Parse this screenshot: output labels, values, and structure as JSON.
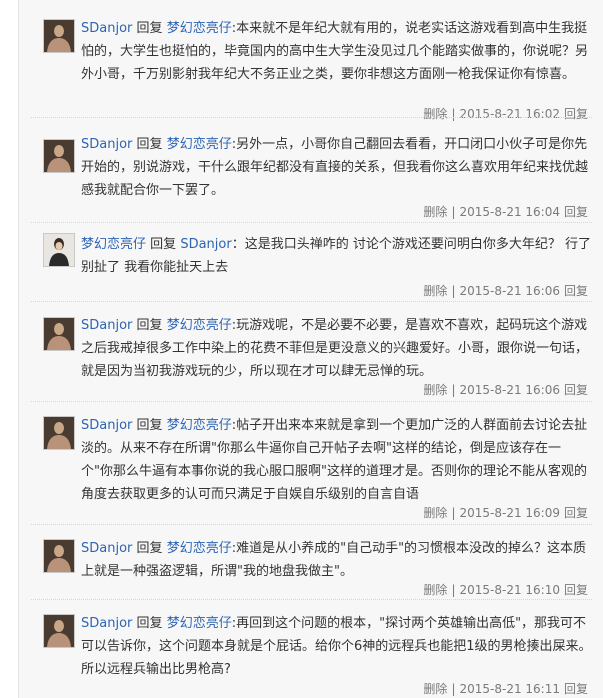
{
  "comments": [
    {
      "author": "SDanjor",
      "reply_word": "回复",
      "target": "梦幻恋亮仔",
      "body": ":本来就不是年纪大就有用的，说老实话这游戏看到高中生我挺怕的，大学生也挺怕的，毕竟国内的高中生大学生没见过几个能踏实做事的，你说呢？另外小哥，千万别影射我年纪大不务正业之类，要你非想这方面刚一枪我保证你有惊喜。",
      "delete": "删除",
      "sep": "|",
      "time": "2015-8-21 16:02",
      "reply": "回复"
    },
    {
      "author": "SDanjor",
      "reply_word": "回复",
      "target": "梦幻恋亮仔",
      "body": ":另外一点，小哥你自己翻回去看看，开口闭口小伙子可是你先开始的，别说游戏，干什么跟年纪都没有直接的关系，但我看你这么喜欢用年纪来找优越感我就配合你一下罢了。",
      "delete": "删除",
      "sep": "|",
      "time": "2015-8-21 16:04",
      "reply": "回复"
    },
    {
      "author": "梦幻恋亮仔",
      "reply_word": "回复",
      "target": "SDanjor",
      "body": "：这是我口头禅咋的 讨论个游戏还要问明白你多大年纪？ 行了别扯了 我看你能扯天上去",
      "delete": "删除",
      "sep": "|",
      "time": "2015-8-21 16:06",
      "reply": "回复"
    },
    {
      "author": "SDanjor",
      "reply_word": "回复",
      "target": "梦幻恋亮仔",
      "body": ":玩游戏呢，不是必要不必要，是喜欢不喜欢，起码玩这个游戏之后我戒掉很多工作中染上的花费不菲但是更没意义的兴趣爱好。小哥，跟你说一句话，就是因为当初我游戏玩的少，所以现在才可以肆无忌惮的玩。",
      "delete": "删除",
      "sep": "|",
      "time": "2015-8-21 16:06",
      "reply": "回复"
    },
    {
      "author": "SDanjor",
      "reply_word": "回复",
      "target": "梦幻恋亮仔",
      "body": ":帖子开出来本来就是拿到一个更加广泛的人群面前去讨论去扯淡的。从来不存在所谓\"你那么牛逼你自己开帖子去啊\"这样的结论，倒是应该存在一个\"你那么牛逼有本事你说的我心服口服啊\"这样的道理才是。否则你的理论不能从客观的角度去获取更多的认可而只满足于自娱自乐级别的自言自语",
      "delete": "删除",
      "sep": "|",
      "time": "2015-8-21 16:09",
      "reply": "回复"
    },
    {
      "author": "SDanjor",
      "reply_word": "回复",
      "target": "梦幻恋亮仔",
      "body": ":难道是从小养成的\"自己动手\"的习惯根本没改的掉么？这本质上就是一种强盗逻辑，所谓\"我的地盘我做主\"。",
      "delete": "删除",
      "sep": "|",
      "time": "2015-8-21 16:10",
      "reply": "回复"
    },
    {
      "author": "SDanjor",
      "reply_word": "回复",
      "target": "梦幻恋亮仔",
      "body": ":再回到这个问题的根本，\"探讨两个英雄输出高低\"，那我可不可以告诉你，这个问题本身就是个屁话。给你个6神的远程兵也能把1级的男枪揍出屎来。所以远程兵输出比男枪高?",
      "delete": "删除",
      "sep": "|",
      "time": "2015-8-21 16:11",
      "reply": "回复"
    }
  ]
}
